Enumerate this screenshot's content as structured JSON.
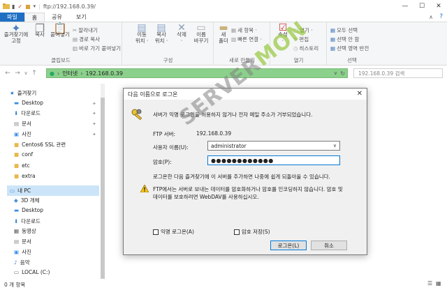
{
  "window": {
    "title": "ftp://192.168.0.39/"
  },
  "ribbon_tabs": [
    "파일",
    "홈",
    "공유",
    "보기"
  ],
  "ribbon": {
    "clipboard": {
      "pin": "즐겨찾기에\n고정",
      "copy": "복사",
      "paste": "붙여넣기",
      "cut": "잘라내기",
      "copy_path": "경로 복사",
      "paste_shortcut": "바로 가기 붙여넣기",
      "label": "클립보드"
    },
    "organize": {
      "move": "이동\n위치 ·",
      "copyto": "복사\n위치 ·",
      "delete": "삭제\n·",
      "rename": "이름\n바꾸기",
      "label": "구성"
    },
    "new": {
      "new_folder": "새\n폴더",
      "new_item": "새 항목 ·",
      "easy_access": "빠른 연결 ·",
      "label": "새로 만들기"
    },
    "open": {
      "properties": "속성\n·",
      "open": "열기 ·",
      "edit": "편집",
      "history": "히스토리",
      "label": "열기"
    },
    "select": {
      "all": "모두 선택",
      "none": "선택 안 함",
      "invert": "선택 영역 반전",
      "label": "선택"
    }
  },
  "address": {
    "crumbs": [
      "인터넷",
      "192.168.0.39"
    ],
    "search_placeholder": "192.168.0.39 검색"
  },
  "nav": {
    "items": [
      {
        "label": "즐겨찾기",
        "icon": "star-icon"
      },
      {
        "label": "Desktop",
        "icon": "desktop-folder-icon"
      },
      {
        "label": "다운로드",
        "icon": "download-icon"
      },
      {
        "label": "문서",
        "icon": "documents-icon"
      },
      {
        "label": "사진",
        "icon": "pictures-icon"
      },
      {
        "label": "Centos6 SSL 관련",
        "icon": "folder-icon"
      },
      {
        "label": "conf",
        "icon": "folder-icon"
      },
      {
        "label": "etc",
        "icon": "folder-icon"
      },
      {
        "label": "extra",
        "icon": "folder-icon"
      },
      {
        "label": "내 PC",
        "icon": "pc-icon"
      },
      {
        "label": "3D 개체",
        "icon": "3d-objects-icon"
      },
      {
        "label": "Desktop",
        "icon": "desktop-folder-icon"
      },
      {
        "label": "다운로드",
        "icon": "download-icon"
      },
      {
        "label": "동영상",
        "icon": "video-icon"
      },
      {
        "label": "문서",
        "icon": "documents-icon"
      },
      {
        "label": "사진",
        "icon": "pictures-icon"
      },
      {
        "label": "음악",
        "icon": "music-icon"
      },
      {
        "label": "LOCAL (C:)",
        "icon": "drive-icon"
      }
    ]
  },
  "status": {
    "count": "0 개 항목"
  },
  "dialog": {
    "title": "다음 이름으로 로그온",
    "message": "서버가 익명 로그인을 허용하지 않거나 전자 메일 주소가 거부되었습니다.",
    "ftp_label": "FTP 서버:",
    "ftp_value": "192.168.0.39",
    "user_label": "사용자 이름(U):",
    "user_value": "administrator",
    "pass_label": "암호(P):",
    "pass_value": "●●●●●●●●●●●●",
    "note": "로그온한 다음 즐겨찾기에 이 서버를 추가하면 나중에 쉽게 되돌아올 수 있습니다.",
    "warning": "FTP에서는 서버로 보내는 데이터를 암호화하거나 암호를 인코딩하지 않습니다. 암호 및",
    "warning2": "데이터를 보호하려면 WebDAV를 사용하십시오.",
    "anon_label": "익명 로그온(A)",
    "save_label": "암호 저장(S)",
    "logon_btn": "로그온(L)",
    "cancel_btn": "취소"
  },
  "watermark": {
    "part1": "SERVER",
    "part2": "MON"
  }
}
